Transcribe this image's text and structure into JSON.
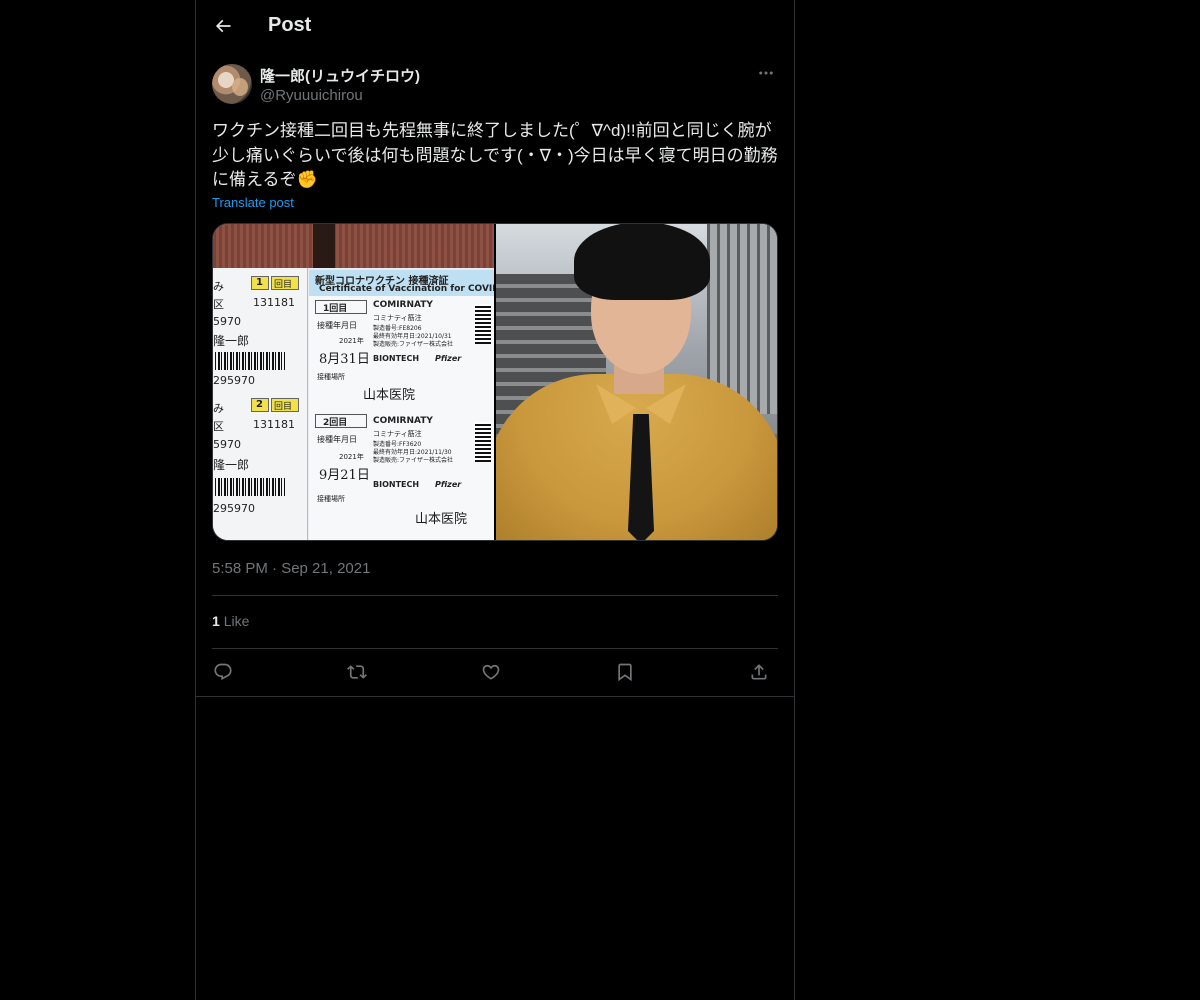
{
  "header": {
    "title": "Post",
    "back_icon": "arrow-left-icon"
  },
  "post": {
    "author": {
      "display_name": "隆一郎(リュウイチロウ)",
      "handle": "@Ryuuuichirou"
    },
    "text": "ワクチン接種二回目も先程無事に終了しました(゜∇^d)!!前回と同じく腕が少し痛いぐらいで後は何も問題なしです(・∇・)今日は早く寝て明日の勤務に備えるぞ✊",
    "translate_label": "Translate post",
    "media": {
      "certificate": {
        "title_jp": "新型コロナワクチン 接種済証",
        "title_en": "Certificate of Vaccination for COVID",
        "dose1": {
          "label": "1回目",
          "vaccine": "COMIRNATY",
          "vaccine_jp": "コミナティ筋注",
          "lot": "製造番号:FE8206",
          "expiry": "最終有効年月日:2021/10/31",
          "seller": "製造販売:ファイザー株式会社",
          "date_label": "接種年月日",
          "year": "2021年",
          "date": "8月31日",
          "place_label": "接種場所",
          "place": "山本医院"
        },
        "dose2": {
          "label": "2回目",
          "vaccine": "COMIRNATY",
          "vaccine_jp": "コミナティ筋注",
          "lot": "製造番号:FF3620",
          "expiry": "最終有効年月日:2021/11/30",
          "seller": "製造販売:ファイザー株式会社",
          "date_label": "接種年月日",
          "year": "2021年",
          "date": "9月21日",
          "place_label": "接種場所",
          "place": "山本医院"
        },
        "left_strip": {
          "row1_badge": "1",
          "row1_badge_label": "回目",
          "code1": "131181",
          "ward1": "区",
          "num1": "5970",
          "name1": "隆一郎",
          "barcode1_num": "295970",
          "row2_badge": "2",
          "row2_badge_label": "回目",
          "code2": "131181",
          "ward2": "区",
          "num2": "5970",
          "name2": "隆一郎",
          "barcode2_num": "295970"
        },
        "brand_biontech": "BIONTECH",
        "brand_pfizer": "Pfizer"
      }
    },
    "timestamp": "5:58 PM · Sep 21, 2021",
    "likes": {
      "count": "1",
      "label": "Like"
    }
  },
  "actions": [
    {
      "name": "reply",
      "icon": "reply-icon"
    },
    {
      "name": "repost",
      "icon": "repost-icon"
    },
    {
      "name": "like",
      "icon": "heart-icon"
    },
    {
      "name": "bookmark",
      "icon": "bookmark-icon"
    },
    {
      "name": "share",
      "icon": "share-icon"
    }
  ],
  "colors": {
    "background": "#000000",
    "text_primary": "#e7e9ea",
    "text_secondary": "#71767b",
    "accent": "#1d9bf0",
    "border": "#2f3336"
  }
}
